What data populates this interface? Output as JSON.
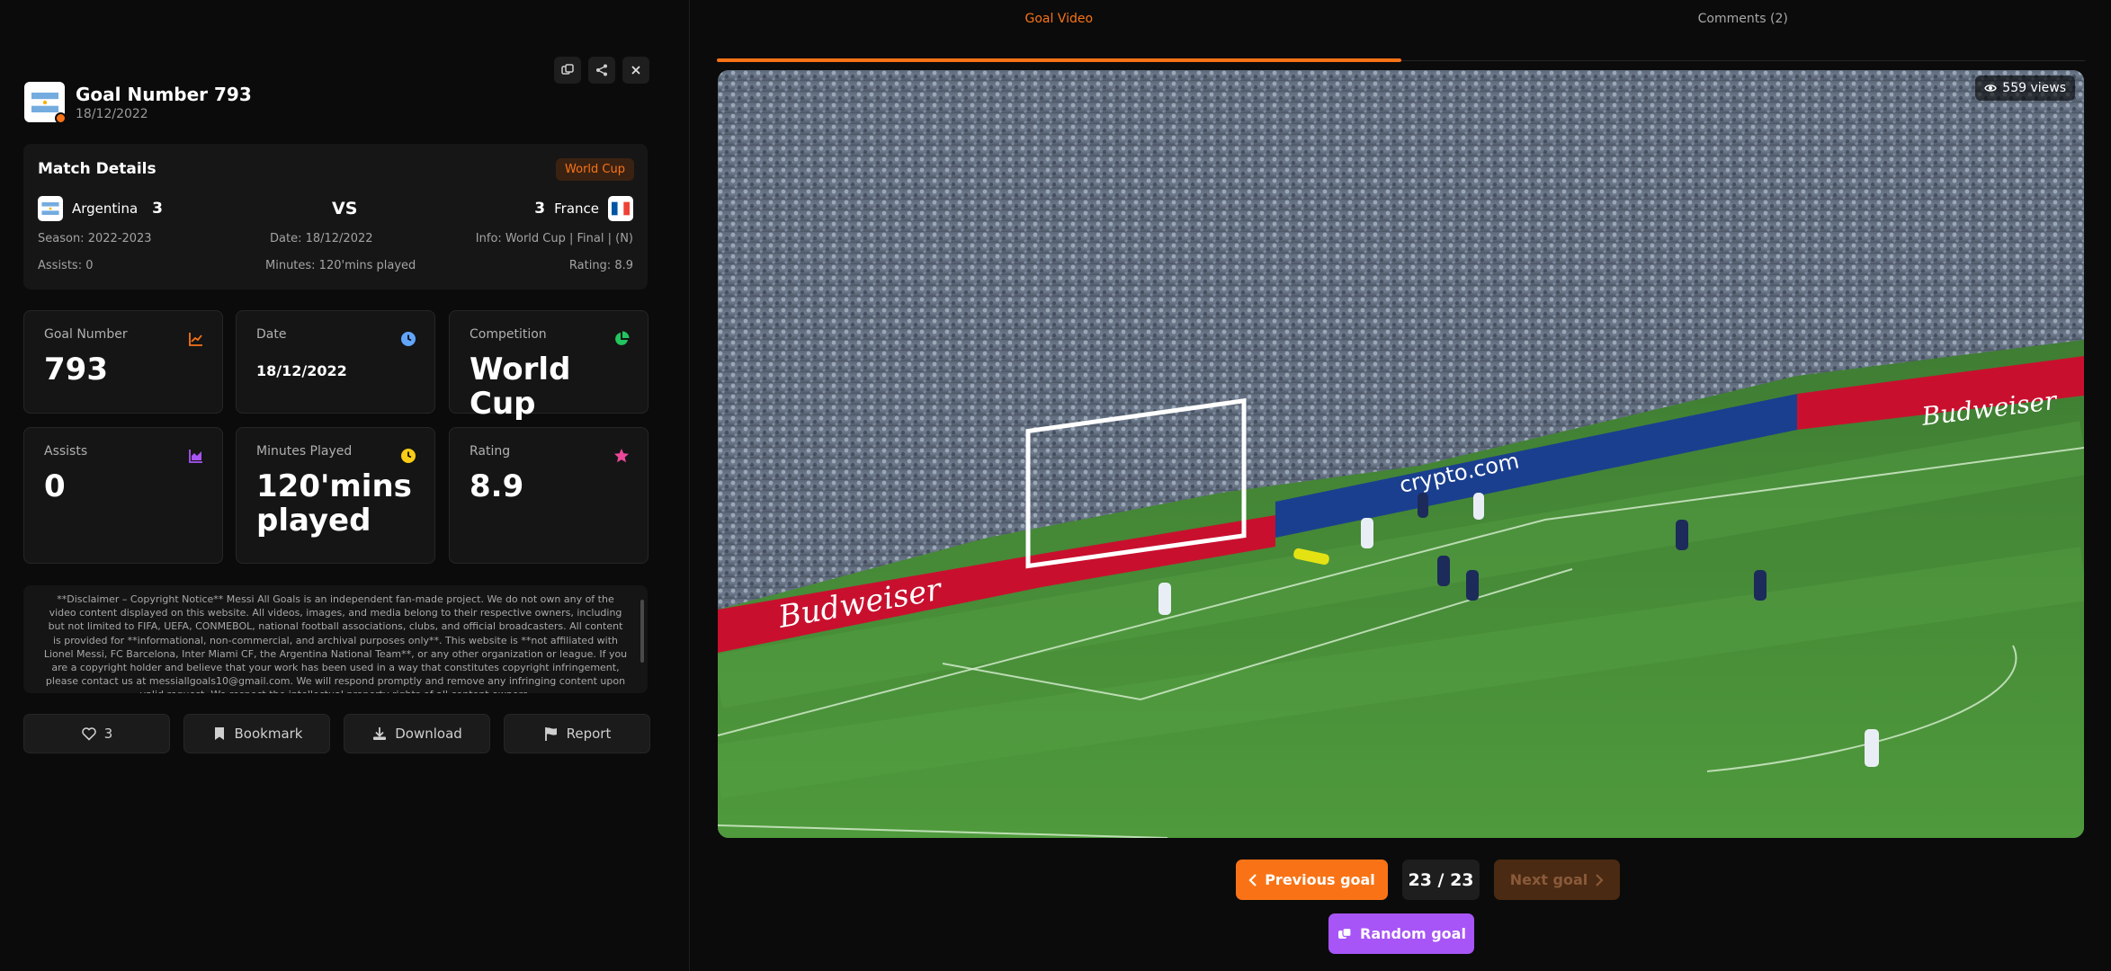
{
  "header": {
    "title": "Goal Number 793",
    "date": "18/12/2022"
  },
  "match": {
    "title": "Match Details",
    "competition_badge": "World Cup",
    "home_team": "Argentina",
    "home_score": "3",
    "vs": "VS",
    "away_team": "France",
    "away_score": "3",
    "season": "Season: 2022-2023",
    "date": "Date: 18/12/2022",
    "info": "Info: World Cup | Final | (N)",
    "assists": "Assists: 0",
    "minutes": "Minutes: 120'mins played",
    "rating": "Rating: 8.9"
  },
  "stats": [
    {
      "label": "Goal Number",
      "value": "793",
      "icon": "chart-line-icon",
      "color": "#f97316"
    },
    {
      "label": "Date",
      "value": "18/12/2022",
      "icon": "clock-icon",
      "color": "#60a5fa"
    },
    {
      "label": "Competition",
      "value": "World Cup",
      "icon": "pie-chart-icon",
      "color": "#22c55e"
    },
    {
      "label": "Assists",
      "value": "0",
      "icon": "area-chart-icon",
      "color": "#a855f7"
    },
    {
      "label": "Minutes Played",
      "value": "120'mins played",
      "icon": "clock-icon",
      "color": "#facc15"
    },
    {
      "label": "Rating",
      "value": "8.9",
      "icon": "star-icon",
      "color": "#ec4899"
    }
  ],
  "disclaimer": "**Disclaimer – Copyright Notice** Messi All Goals is an independent fan-made project. We do not own any of the video content displayed on this website. All videos, images, and media belong to their respective owners, including but not limited to FIFA, UEFA, CONMEBOL, national football associations, clubs, and official broadcasters. All content is provided for **informational, non-commercial, and archival purposes only**. This website is **not affiliated with Lionel Messi, FC Barcelona, Inter Miami CF, the Argentina National Team**, or any other organization or league. If you are a copyright holder and believe that your work has been used in a way that constitutes copyright infringement, please contact us at messiallgoals10@gmail.com. We will respond promptly and remove any infringing content upon valid request. We respect the intellectual property rights of all content owners.",
  "actions": {
    "likes": "3",
    "bookmark": "Bookmark",
    "download": "Download",
    "report": "Report"
  },
  "tabs": {
    "video": "Goal Video",
    "comments": "Comments (2)"
  },
  "video": {
    "views": "559 views"
  },
  "nav": {
    "previous": "Previous goal",
    "counter": "23 / 23",
    "next": "Next goal",
    "random": "Random goal"
  },
  "colors": {
    "accent": "#f97316",
    "random": "#a855f7"
  }
}
